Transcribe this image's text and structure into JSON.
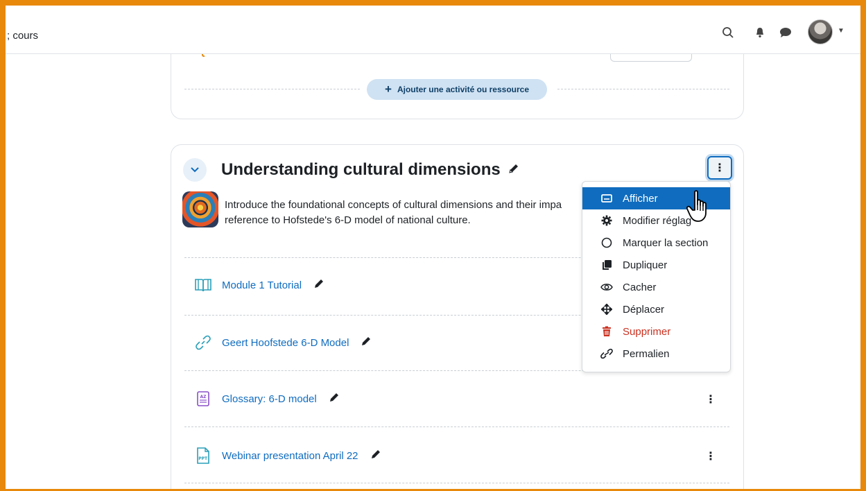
{
  "navbar": {
    "partial_text": "; cours",
    "icons": [
      "search-icon",
      "bell-icon",
      "chat-icon",
      "chevron-down-icon"
    ]
  },
  "previous_section": {
    "add_button_label": "Ajouter une activité ou ressource",
    "add_button_plus": "+"
  },
  "section": {
    "title": "Understanding cultural dimensions",
    "description_line1": "Introduce the foundational concepts of cultural dimensions and their impa",
    "description_line2": "reference to Hofstede's 6-D model of national culture.",
    "kebab": "⋮",
    "activities": [
      {
        "label": "Module 1 Tutorial",
        "icon": "book-icon"
      },
      {
        "label": "Geert Hoofstede 6-D Model",
        "icon": "link-icon"
      },
      {
        "label": "Glossary: 6-D model",
        "icon": "glossary-icon"
      },
      {
        "label": "Webinar presentation April 22",
        "icon": "ppt-file-icon"
      }
    ]
  },
  "menu": {
    "items": [
      {
        "label": "Afficher",
        "icon": "display-icon",
        "state": "highlighted"
      },
      {
        "label": "Modifier réglag",
        "icon": "gear-icon"
      },
      {
        "label": "Marquer la section",
        "icon": "circle-icon"
      },
      {
        "label": "Dupliquer",
        "icon": "copy-icon"
      },
      {
        "label": "Cacher",
        "icon": "eye-icon"
      },
      {
        "label": "Déplacer",
        "icon": "move-icon"
      },
      {
        "label": "Supprimer",
        "icon": "trash-icon",
        "state": "danger"
      },
      {
        "label": "Permalien",
        "icon": "permalink-icon"
      }
    ]
  },
  "colors": {
    "frame": "#e8890c",
    "primary": "#0f6cbf",
    "danger": "#ca3120",
    "add_button_bg": "#cfe2f3"
  }
}
